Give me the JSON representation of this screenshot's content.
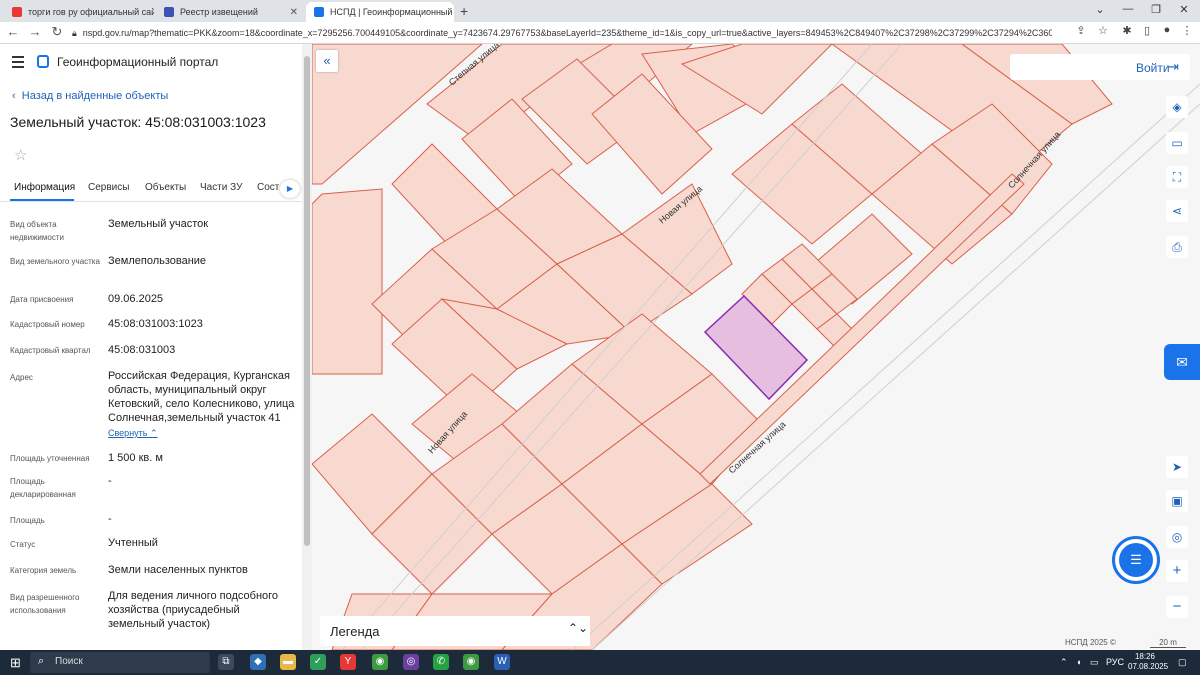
{
  "browser": {
    "tabs": [
      {
        "title": "торги гов ру официальный сай",
        "color": "#e53935"
      },
      {
        "title": "Реестр извещений",
        "color": "#3f51b5"
      },
      {
        "title": "НСПД | Геоинформационный п",
        "color": "#1a73e8"
      }
    ],
    "url": "nspd.gov.ru/map?thematic=PKK&zoom=18&coordinate_x=7295256.700449105&coordinate_y=7423674.29767753&baseLayerId=235&theme_id=1&is_copy_url=true&active_layers=849453%2C849407%2C37298%2C37299%2C37294%2C36048"
  },
  "panel": {
    "portal_title": "Геоинформационный портал",
    "back_label": "Назад в найденные объекты",
    "object_title": "Земельный участок: 45:08:031003:1023",
    "tabs": [
      "Информация",
      "Сервисы",
      "Объекты",
      "Части ЗУ",
      "Соста"
    ],
    "fields": [
      {
        "label": "Вид объекта недвижимости",
        "value": "Земельный участок"
      },
      {
        "label": "Вид земельного участка",
        "value": "Землепользование"
      },
      {
        "label": "Дата присвоения",
        "value": "09.06.2025"
      },
      {
        "label": "Кадастровый номер",
        "value": "45:08:031003:1023"
      },
      {
        "label": "Кадастровый квартал",
        "value": "45:08:031003"
      },
      {
        "label": "Адрес",
        "value": "Российская Федерация, Курганская область, муниципальный округ Кетовский, село Колесниково, улица Солнечная,земельный участок 41"
      },
      {
        "label": "Площадь уточненная",
        "value": "1 500 кв. м"
      },
      {
        "label": "Площадь декларированная",
        "value": "-"
      },
      {
        "label": "Площадь",
        "value": "-"
      },
      {
        "label": "Статус",
        "value": "Учтенный"
      },
      {
        "label": "Категория земель",
        "value": "Земли населенных пунктов"
      },
      {
        "label": "Вид разрешенного использования",
        "value": "Для ведения личного подсобного хозяйства (приусадебный земельный участок)"
      }
    ],
    "collapse_label": "Свернуть"
  },
  "map": {
    "streets": [
      "Степная улица",
      "Новая улица",
      "Новая улица",
      "Солнечная улица",
      "Солнечная улица"
    ],
    "login_label": "Войти",
    "legend_label": "Легенда",
    "copyright": "НСПД 2025 ©",
    "scale": "20 m",
    "colors": {
      "parcel_fill": "#f8d9d0",
      "parcel_stroke": "#d9604a",
      "selected_fill": "#e6bfe0",
      "selected_stroke": "#8b2bb0",
      "accent": "#1a73e8"
    }
  },
  "taskbar": {
    "search_label": "Поиск",
    "lang": "РУС",
    "time": "18:26",
    "date": "07.08.2025"
  }
}
